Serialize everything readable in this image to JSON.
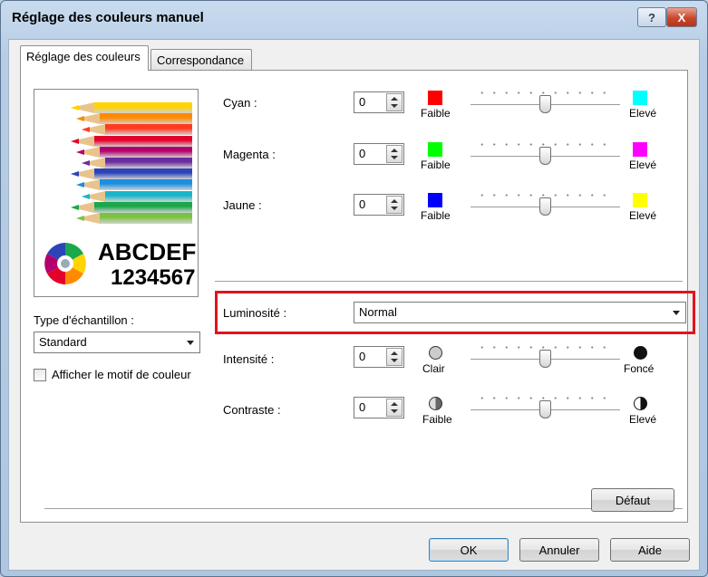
{
  "window": {
    "title": "Réglage des couleurs manuel",
    "help_label": "?",
    "close_label": "X"
  },
  "tabs": [
    {
      "label": "Réglage des couleurs",
      "active": true
    },
    {
      "label": "Correspondance",
      "active": false
    }
  ],
  "preview": {
    "sample_text": "ABCDEF",
    "sample_numbers": "1234567",
    "pencil_colors": [
      "#ffd400",
      "#ff8a00",
      "#ff3b1f",
      "#e4002b",
      "#b4006e",
      "#6a2da0",
      "#2b45b8",
      "#1b8fe0",
      "#19b6c8",
      "#1aa84a",
      "#7cc242"
    ]
  },
  "sample_type": {
    "label": "Type d'échantillon :",
    "value": "Standard"
  },
  "show_pattern": {
    "label": "Afficher le motif de couleur",
    "checked": false
  },
  "color_sliders": [
    {
      "label": "Cyan :",
      "value": "0",
      "left_label": "Faible",
      "right_label": "Elevé",
      "left_color": "#ff0000",
      "right_color": "#00ffff",
      "level": 0.5
    },
    {
      "label": "Magenta :",
      "value": "0",
      "left_label": "Faible",
      "right_label": "Elevé",
      "left_color": "#00ff00",
      "right_color": "#ff00ff",
      "level": 0.5
    },
    {
      "label": "Jaune :",
      "value": "0",
      "left_label": "Faible",
      "right_label": "Elevé",
      "left_color": "#0000ff",
      "right_color": "#ffff00",
      "level": 0.5
    }
  ],
  "brightness": {
    "label": "Luminosité :",
    "value": "Normal",
    "highlight_color": "#e0141e"
  },
  "tone_sliders": [
    {
      "label": "Intensité :",
      "value": "0",
      "left_label": "Clair",
      "right_label": "Foncé",
      "left_icon": "light-circle-icon",
      "right_icon": "dark-circle-icon",
      "level": 0.5
    },
    {
      "label": "Contraste :",
      "value": "0",
      "left_label": "Faible",
      "right_label": "Elevé",
      "left_icon": "low-contrast-icon",
      "right_icon": "high-contrast-icon",
      "level": 0.5
    }
  ],
  "buttons": {
    "default": "Défaut",
    "ok": "OK",
    "cancel": "Annuler",
    "help": "Aide"
  }
}
